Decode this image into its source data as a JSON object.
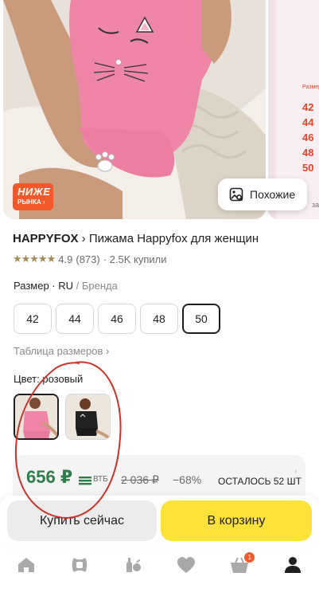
{
  "gallery": {
    "badge": {
      "line1": "НИЖЕ",
      "line2": "РЫНКА ›"
    },
    "similar_button": "Похожие",
    "next_photo_header": "Размер",
    "next_photo_sizes": [
      "42",
      "44",
      "46",
      "48",
      "50"
    ],
    "next_photo_tail": "за"
  },
  "product": {
    "brand": "HAPPYFOX",
    "separator": " › ",
    "name": "Пижама Happyfox для женщин",
    "rating_value": "4.9",
    "reviews": "(873)",
    "bought": "· 2.5K купили",
    "stars": 5
  },
  "size_section": {
    "label": "Размер",
    "dot": " · ",
    "system": "RU",
    "system_sub": " / Бренда",
    "options": [
      "42",
      "44",
      "46",
      "48",
      "50"
    ],
    "selected": "50",
    "table_link": "Таблица размеров ›"
  },
  "color_section": {
    "label": "Цвет: розовый",
    "swatches": [
      "pink",
      "black"
    ],
    "selected": "pink"
  },
  "price": {
    "current": "656 ₽",
    "bank": "ВТБ",
    "old": "2 036 ₽",
    "discount": "−68%",
    "stock": "ОСТАЛОСЬ 52 ШТ"
  },
  "actions": {
    "buy_now": "Купить сейчас",
    "add_to_cart": "В корзину"
  },
  "tabbar": {
    "items": [
      "home",
      "catalog",
      "brands",
      "favorites",
      "cart",
      "profile"
    ],
    "cart_count": "1"
  },
  "colors": {
    "accent_yellow": "#fde23a",
    "price_green": "#2e7d4a",
    "badge_orange": "#f25a2c",
    "annotation_red": "#c8332a"
  }
}
